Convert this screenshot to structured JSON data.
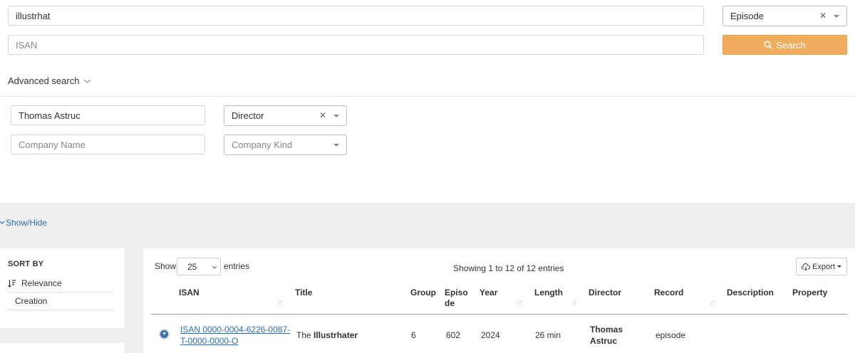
{
  "search": {
    "title_value": "illustrhat",
    "type_select": "Episode",
    "isan_placeholder": "ISAN",
    "search_label": "Search"
  },
  "advanced": {
    "title": "Advanced search",
    "person_value": "Thomas Astruc",
    "role_select": "Director",
    "company_placeholder": "Company Name",
    "company_kind_placeholder": "Company Kind"
  },
  "show_hide_label": "Show/Hide",
  "sort": {
    "title": "SORT BY",
    "items": [
      "Relevance",
      "Creation"
    ]
  },
  "table_controls": {
    "show_label": "Show",
    "entries_label": "entries",
    "page_length": "25",
    "info": "Showing 1 to 12 of 12 entries",
    "export_label": "Export"
  },
  "table": {
    "columns": {
      "isan": "ISAN",
      "title": "Title",
      "group": "Group",
      "episode_l1": "Episo",
      "episode_l2": "de",
      "year": "Year",
      "length": "Length",
      "director": "Director",
      "record": "Record",
      "description": "Description",
      "property": "Property"
    },
    "rows": [
      {
        "isan_l1": "ISAN 0000-0004-6226-0087-",
        "isan_l2": "T-0000-0000-O",
        "title_prefix": "The ",
        "title_bold": "Illustrhater",
        "group": "6",
        "episode": "602",
        "year": "2024",
        "length": "26 min",
        "director_l1": "Thomas",
        "director_l2": "Astruc",
        "record": "episode"
      }
    ]
  },
  "icons": {
    "search": "search-icon",
    "chevron": "chevron-down-icon",
    "sort": "sort-icon",
    "export": "cloud-download-icon",
    "expand": "plus-circle-icon"
  },
  "colors": {
    "accent": "#f0ad5e",
    "link": "#2a6ebb",
    "band": "#efefef"
  }
}
